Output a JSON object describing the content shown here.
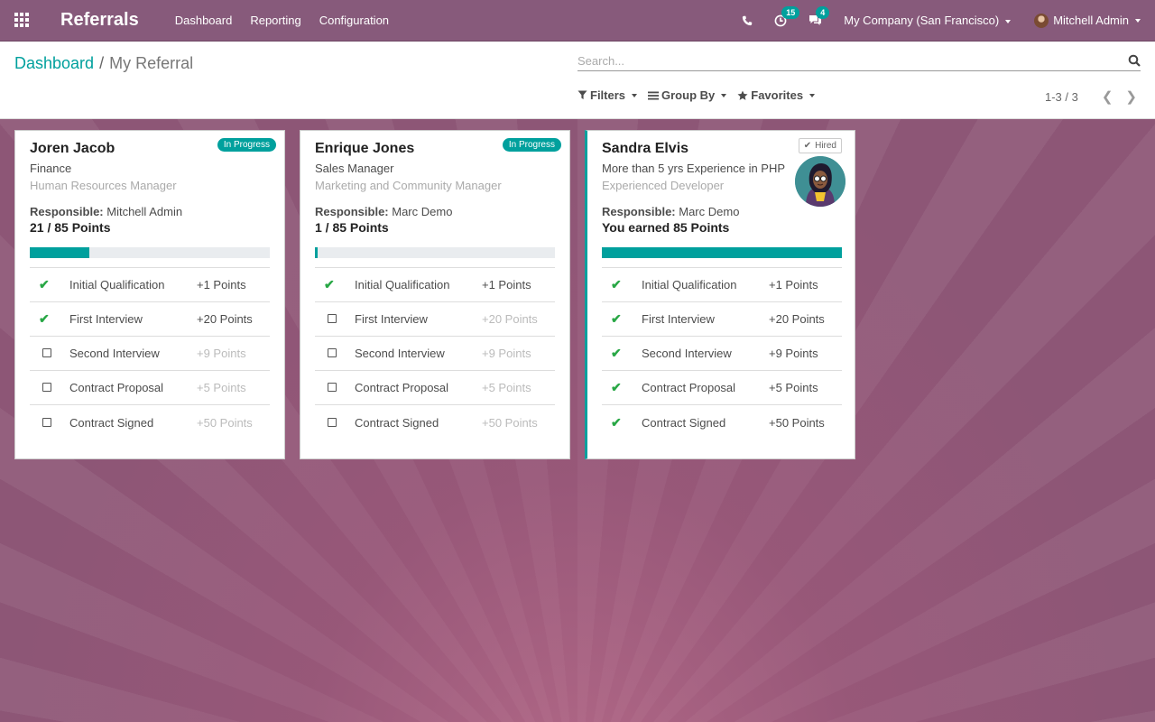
{
  "app": {
    "title": "Referrals",
    "menu": [
      "Dashboard",
      "Reporting",
      "Configuration"
    ],
    "activity_count": "15",
    "messages_count": "4",
    "company": "My Company (San Francisco)",
    "user": "Mitchell Admin",
    "icons": [
      "apps-icon",
      "phone-icon",
      "clock-icon",
      "chat-icon",
      "user-avatar"
    ]
  },
  "breadcrumb": {
    "parent": "Dashboard",
    "separator": "/",
    "current": "My Referral"
  },
  "search": {
    "placeholder": "Search...",
    "value": ""
  },
  "filters": {
    "filters": "Filters",
    "group_by": "Group By",
    "favorites": "Favorites"
  },
  "pager": {
    "value": "1-3 / 3"
  },
  "colors": {
    "brand": "#875a7b",
    "accent": "#00a09d",
    "check": "#28a745"
  },
  "cards": [
    {
      "name": "Joren Jacob",
      "status": "In Progress",
      "department": "Finance",
      "job": "Human Resources Manager",
      "responsible_label": "Responsible:",
      "responsible": "Mitchell Admin",
      "points": "21 / 85 Points",
      "progress": 0.247,
      "stages": [
        {
          "label": "Initial Qualification",
          "points": "+1 Points",
          "done": true
        },
        {
          "label": "First Interview",
          "points": "+20 Points",
          "done": true
        },
        {
          "label": "Second Interview",
          "points": "+9 Points",
          "done": false
        },
        {
          "label": "Contract Proposal",
          "points": "+5 Points",
          "done": false
        },
        {
          "label": "Contract Signed",
          "points": "+50 Points",
          "done": false
        }
      ]
    },
    {
      "name": "Enrique Jones",
      "status": "In Progress",
      "department": "Sales Manager",
      "job": "Marketing and Community Manager",
      "responsible_label": "Responsible:",
      "responsible": "Marc Demo",
      "points": "1 / 85 Points",
      "progress": 0.012,
      "stages": [
        {
          "label": "Initial Qualification",
          "points": "+1 Points",
          "done": true
        },
        {
          "label": "First Interview",
          "points": "+20 Points",
          "done": false
        },
        {
          "label": "Second Interview",
          "points": "+9 Points",
          "done": false
        },
        {
          "label": "Contract Proposal",
          "points": "+5 Points",
          "done": false
        },
        {
          "label": "Contract Signed",
          "points": "+50 Points",
          "done": false
        }
      ]
    },
    {
      "name": "Sandra Elvis",
      "status": "Hired",
      "department": "More than 5 yrs Experience in PHP",
      "job": "Experienced Developer",
      "responsible_label": "Responsible:",
      "responsible": "Marc Demo",
      "points": "You earned 85 Points",
      "progress": 1.0,
      "stages": [
        {
          "label": "Initial Qualification",
          "points": "+1 Points",
          "done": true
        },
        {
          "label": "First Interview",
          "points": "+20 Points",
          "done": true
        },
        {
          "label": "Second Interview",
          "points": "+9 Points",
          "done": true
        },
        {
          "label": "Contract Proposal",
          "points": "+5 Points",
          "done": true
        },
        {
          "label": "Contract Signed",
          "points": "+50 Points",
          "done": true
        }
      ]
    }
  ]
}
